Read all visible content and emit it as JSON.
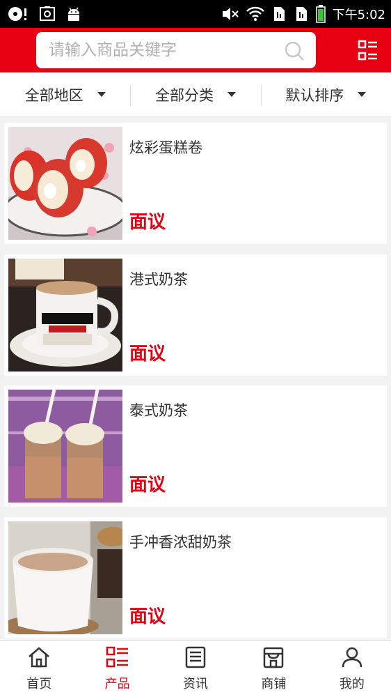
{
  "status_bar": {
    "time": "下午5:02",
    "icons_left": [
      "cd-icon",
      "screenshot-icon",
      "android-icon"
    ],
    "icons_right": [
      "mute-icon",
      "wifi-icon",
      "sim1-icon",
      "sim2-icon",
      "battery-icon"
    ]
  },
  "header": {
    "search_placeholder": "请输入商品关键字",
    "search_icon": "search-icon",
    "menu_icon": "category-menu-icon",
    "brand_color": "#e60012"
  },
  "filters": [
    {
      "label": "全部地区"
    },
    {
      "label": "全部分类"
    },
    {
      "label": "默认排序"
    }
  ],
  "products": [
    {
      "name": "炫彩蛋糕卷",
      "price": "面议",
      "image": "cake-roll-photo"
    },
    {
      "name": "港式奶茶",
      "price": "面议",
      "image": "hk-milk-tea-photo"
    },
    {
      "name": "泰式奶茶",
      "price": "面议",
      "image": "thai-milk-tea-photo"
    },
    {
      "name": "手冲香浓甜奶茶",
      "price": "面议",
      "image": "hand-brewed-milk-tea-photo"
    }
  ],
  "tabbar": {
    "active_color": "#e60012",
    "items": [
      {
        "label": "首页",
        "icon": "home-icon"
      },
      {
        "label": "产品",
        "icon": "product-list-icon",
        "active": true
      },
      {
        "label": "资讯",
        "icon": "news-icon"
      },
      {
        "label": "商铺",
        "icon": "shop-icon"
      },
      {
        "label": "我的",
        "icon": "user-icon"
      }
    ]
  }
}
